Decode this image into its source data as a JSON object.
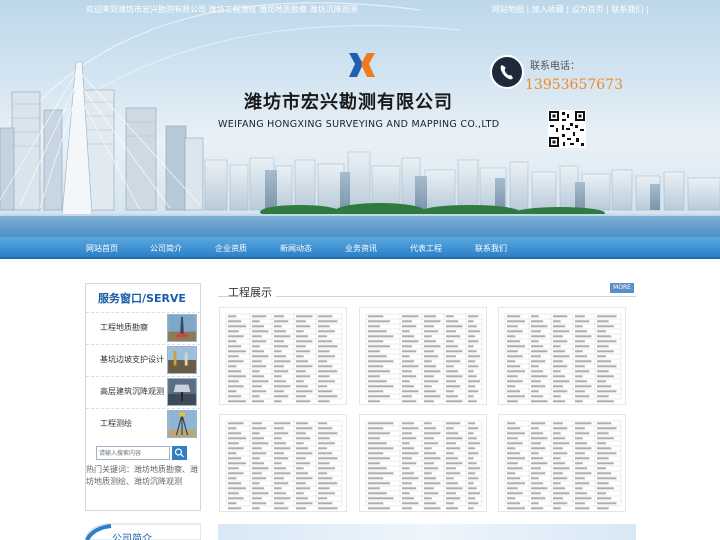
{
  "topbar": {
    "welcome": "欢迎来到潍坊市宏兴勘测有限公司 潍坊工程测绘 潍坊地质勘察 潍坊沉降观测",
    "links": [
      "网站地图",
      "加入收藏",
      "设为首页",
      "联系我们"
    ]
  },
  "brand": {
    "name_cn": "潍坊市宏兴勘测有限公司",
    "name_en": "WEIFANG HONGXING SURVEYING AND MAPPING CO.,LTD",
    "logo_icon": "xh-logo-icon",
    "accent": "#2b80c8"
  },
  "contact": {
    "label": "联系电话：",
    "phone": "13953657673",
    "phone_icon": "phone-icon",
    "phone_color": "#f08a24"
  },
  "nav": {
    "items": [
      "网站首页",
      "公司简介",
      "企业资质",
      "新闻动态",
      "业务资讯",
      "代表工程",
      "联系我们"
    ]
  },
  "sidebar": {
    "title": "服务窗口/SERVE",
    "services": [
      "工程地质勘察",
      "基坑边坡支护设计",
      "高层建筑沉降观测",
      "工程测绘"
    ],
    "search_placeholder": "请输入搜索内容",
    "hot_keywords": "热门关键词：潍坊地质勘察、潍坊地质测绘、潍坊沉降观测"
  },
  "projects": {
    "title": "工程展示",
    "more_label": "MORE"
  },
  "intro": {
    "title": "公司简介"
  }
}
